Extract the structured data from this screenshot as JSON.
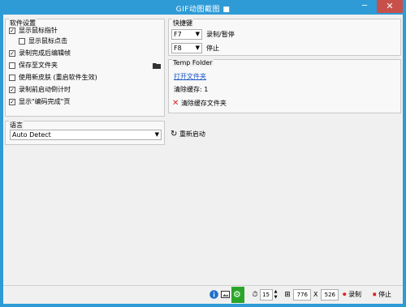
{
  "window": {
    "title": "GIF动图截图 ■",
    "minimize": "─",
    "maximize": "▭",
    "close": "✕"
  },
  "software_settings": {
    "title": "软件设置",
    "items": [
      {
        "label": "显示鼠标指针",
        "checked": true
      },
      {
        "label": "显示鼠标点击",
        "checked": false
      },
      {
        "label": "录制完成后编辑帧",
        "checked": true
      },
      {
        "label": "保存至文件夹",
        "checked": false
      },
      {
        "label": "使用新皮肤 (重启软件生效)",
        "checked": false
      },
      {
        "label": "录制前启动倒计时",
        "checked": true
      },
      {
        "label": "显示\"编码完成\"页",
        "checked": true
      }
    ]
  },
  "language": {
    "title": "语言",
    "selected": "Auto Detect"
  },
  "hotkeys": {
    "title": "快捷键",
    "items": [
      {
        "key": "F7",
        "label": "录制/暂停"
      },
      {
        "key": "F8",
        "label": "停止"
      }
    ]
  },
  "temp_folder": {
    "title": "Temp Folder",
    "open_link": "打开文件夹",
    "clear_cache_text": "清除缓存: 1",
    "clear_button": "清除缓存文件夹"
  },
  "restart_button": "重新启动",
  "statusbar": {
    "fps": "15",
    "width": "776",
    "separator": "X",
    "height": "526",
    "record_label": "录制",
    "stop_label": "停止"
  },
  "colors": {
    "titlebar": "#2f9bd6",
    "close_button": "#c7504b",
    "link": "#1a56c4",
    "settings_icon_bg": "#2aa52a"
  }
}
